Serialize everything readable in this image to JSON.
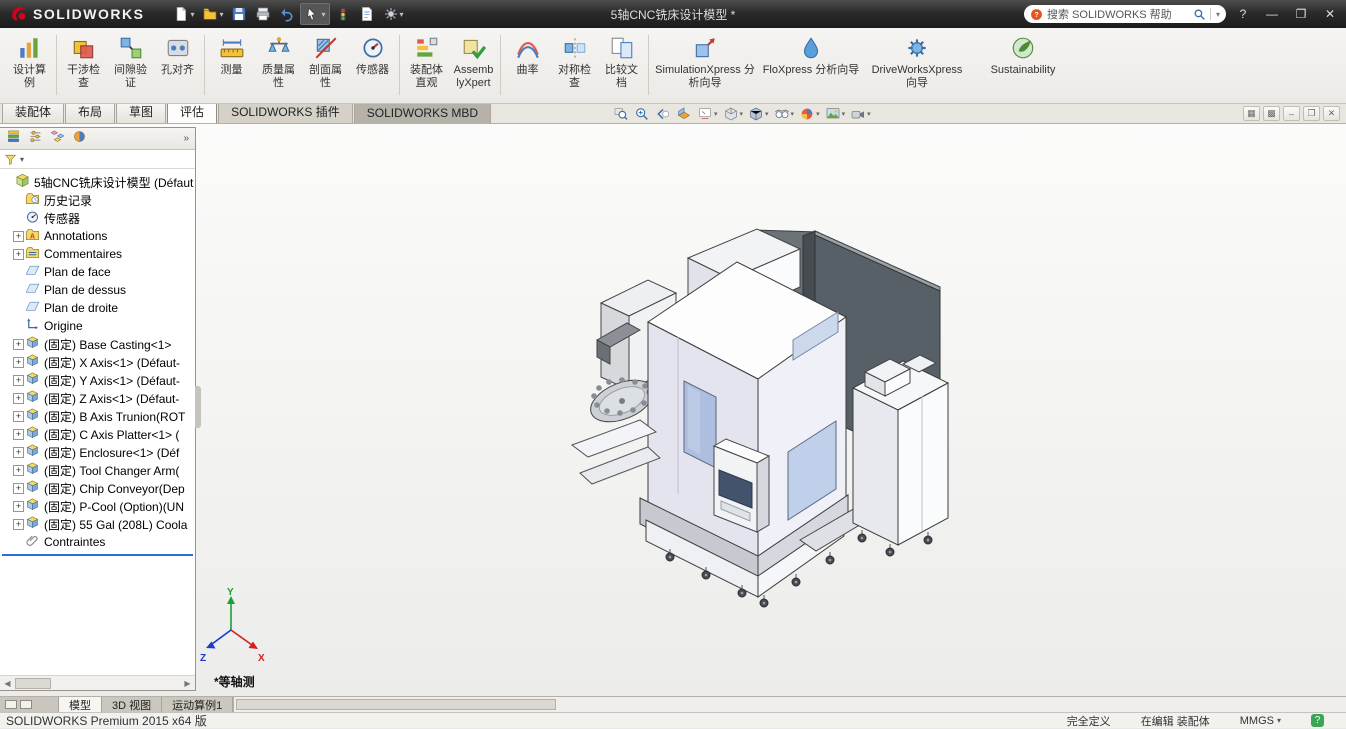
{
  "titlebar": {
    "app_name": "SOLIDWORKS",
    "document_title": "5轴CNC铣床设计模型 *",
    "quick_access_icons": [
      "new-document-icon",
      "open-icon",
      "save-icon",
      "print-icon",
      "undo-icon",
      "select-arrow-icon",
      "rebuild-icon",
      "file-properties-icon",
      "options-gear-icon"
    ],
    "search": {
      "placeholder": "搜索 SOLIDWORKS 帮助"
    },
    "window_controls": [
      "help-icon",
      "minimize-icon",
      "maximize-icon",
      "close-icon"
    ]
  },
  "ribbon": {
    "groups": [
      {
        "items": [
          {
            "label": "设计算例",
            "icon": "design-study-icon"
          }
        ]
      },
      {
        "items": [
          {
            "label": "干涉检查",
            "icon": "interference-check-icon"
          },
          {
            "label": "间隙验证",
            "icon": "clearance-verify-icon"
          },
          {
            "label": "孔对齐",
            "icon": "hole-alignment-icon"
          }
        ]
      },
      {
        "items": [
          {
            "label": "测量",
            "icon": "measure-icon"
          },
          {
            "label": "质量属性",
            "icon": "mass-properties-icon"
          },
          {
            "label": "剖面属性",
            "icon": "section-properties-icon"
          },
          {
            "label": "传感器",
            "icon": "sensor-icon"
          }
        ]
      },
      {
        "items": [
          {
            "label": "装配体直观",
            "icon": "assembly-visualization-icon"
          },
          {
            "label": "AssemblyXpert",
            "icon": "assemblyxpert-icon"
          }
        ]
      },
      {
        "items": [
          {
            "label": "曲率",
            "icon": "curvature-icon"
          },
          {
            "label": "对称检查",
            "icon": "symmetry-check-icon"
          },
          {
            "label": "比较文档",
            "icon": "compare-documents-icon"
          }
        ]
      },
      {
        "items": [
          {
            "label": "SimulationXpress 分析向导",
            "icon": "simulationxpress-icon"
          },
          {
            "label": "FloXpress 分析向导",
            "icon": "floxpress-icon"
          },
          {
            "label": "DriveWorksXpress 向导",
            "icon": "driveworksxpress-icon"
          },
          {
            "label": "Sustainability",
            "icon": "sustainability-icon"
          }
        ]
      }
    ]
  },
  "command_tabs": [
    {
      "id": "assembly",
      "label": "装配体",
      "active": false,
      "style": "normal"
    },
    {
      "id": "layout",
      "label": "布局",
      "active": false,
      "style": "normal"
    },
    {
      "id": "sketch",
      "label": "草图",
      "active": false,
      "style": "normal"
    },
    {
      "id": "evaluate",
      "label": "评估",
      "active": true,
      "style": "normal"
    },
    {
      "id": "solidworks-addins",
      "label": "SOLIDWORKS 插件",
      "active": false,
      "style": "addin"
    },
    {
      "id": "solidworks-mbd",
      "label": "SOLIDWORKS MBD",
      "active": false,
      "style": "mbd"
    }
  ],
  "headsup_toolbar": [
    {
      "icon": "zoom-fit-icon",
      "dropdown": false
    },
    {
      "icon": "zoom-area-icon",
      "dropdown": false
    },
    {
      "icon": "previous-view-icon",
      "dropdown": false
    },
    {
      "icon": "section-view-icon",
      "dropdown": false
    },
    {
      "icon": "annotation-view-icon",
      "dropdown": true
    },
    {
      "icon": "view-orientation-icon",
      "dropdown": true
    },
    {
      "icon": "display-style-icon",
      "dropdown": true
    },
    {
      "icon": "hide-show-items-icon",
      "dropdown": true
    },
    {
      "icon": "edit-appearance-icon",
      "dropdown": true
    },
    {
      "icon": "apply-scene-icon",
      "dropdown": true
    },
    {
      "icon": "view-settings-icon",
      "dropdown": true
    }
  ],
  "mdi_controls": [
    "doc-tile-icon",
    "doc-cascade-icon",
    "doc-minimize-icon",
    "doc-restore-icon",
    "doc-close-icon"
  ],
  "feature_panel": {
    "panel_tabs": [
      "featuremanager-tab-icon",
      "propertymanager-tab-icon",
      "configurationmanager-tab-icon",
      "displaymanager-tab-icon"
    ],
    "expand_glyph": "»",
    "filter_icon": "filter-funnel-icon",
    "tree": [
      {
        "label": "5轴CNC铣床设计模型 (Défaut",
        "icon": "assembly-icon",
        "indent": 0,
        "expander": "none"
      },
      {
        "label": "历史记录",
        "icon": "history-folder-icon",
        "indent": 1,
        "expander": "none"
      },
      {
        "label": "传感器",
        "icon": "sensors-icon",
        "indent": 1,
        "expander": "none"
      },
      {
        "label": "Annotations",
        "icon": "annotations-folder-icon",
        "indent": 1,
        "expander": "plus"
      },
      {
        "label": "Commentaires",
        "icon": "comments-folder-icon",
        "indent": 1,
        "expander": "plus"
      },
      {
        "label": "Plan de face",
        "icon": "plane-icon",
        "indent": 1,
        "expander": "none"
      },
      {
        "label": "Plan de dessus",
        "icon": "plane-icon",
        "indent": 1,
        "expander": "none"
      },
      {
        "label": "Plan de droite",
        "icon": "plane-icon",
        "indent": 1,
        "expander": "none"
      },
      {
        "label": "Origine",
        "icon": "origin-icon",
        "indent": 1,
        "expander": "none"
      },
      {
        "label": "(固定) Base  Casting<1>",
        "icon": "component-icon",
        "indent": 1,
        "expander": "plus"
      },
      {
        "label": "(固定) X Axis<1> (Défaut-",
        "icon": "component-icon",
        "indent": 1,
        "expander": "plus"
      },
      {
        "label": "(固定) Y Axis<1> (Défaut-",
        "icon": "component-icon",
        "indent": 1,
        "expander": "plus"
      },
      {
        "label": "(固定) Z Axis<1> (Défaut-",
        "icon": "component-icon",
        "indent": 1,
        "expander": "plus"
      },
      {
        "label": "(固定) B Axis Trunion(ROT",
        "icon": "component-icon",
        "indent": 1,
        "expander": "plus"
      },
      {
        "label": "(固定) C Axis Platter<1> (",
        "icon": "component-icon",
        "indent": 1,
        "expander": "plus"
      },
      {
        "label": "(固定) Enclosure<1> (Déf",
        "icon": "component-icon",
        "indent": 1,
        "expander": "plus"
      },
      {
        "label": "(固定) Tool Changer Arm(",
        "icon": "component-icon",
        "indent": 1,
        "expander": "plus"
      },
      {
        "label": "(固定) Chip Conveyor(Dep",
        "icon": "component-icon",
        "indent": 1,
        "expander": "plus"
      },
      {
        "label": "(固定) P-Cool (Option)(UN",
        "icon": "component-icon",
        "indent": 1,
        "expander": "plus"
      },
      {
        "label": "(固定) 55 Gal (208L) Coola",
        "icon": "component-icon",
        "indent": 1,
        "expander": "plus"
      },
      {
        "label": "Contraintes",
        "icon": "mates-icon",
        "indent": 1,
        "expander": "none"
      }
    ]
  },
  "viewport": {
    "view_label": "*等轴测",
    "triad_labels": {
      "x": "X",
      "y": "Y",
      "z": "Z"
    }
  },
  "bottom_tabs": [
    {
      "id": "model",
      "label": "模型",
      "active": true
    },
    {
      "id": "3d-views",
      "label": "3D 视图",
      "active": false
    },
    {
      "id": "motion-study-1",
      "label": "运动算例1",
      "active": false
    }
  ],
  "statusbar": {
    "left_text": "SOLIDWORKS Premium 2015 x64 版",
    "define_status": "完全定义",
    "edit_status": "在编辑 装配体",
    "units": "MMGS"
  },
  "colors": {
    "titlebar_bg": "#2b2b2b",
    "logo_red": "#d6001c",
    "viewport_bg": "#f6f6f4",
    "rollback_blue": "#2a6fd4",
    "window_glass": "#aebedf",
    "rear_wall_gray": "#566066"
  }
}
